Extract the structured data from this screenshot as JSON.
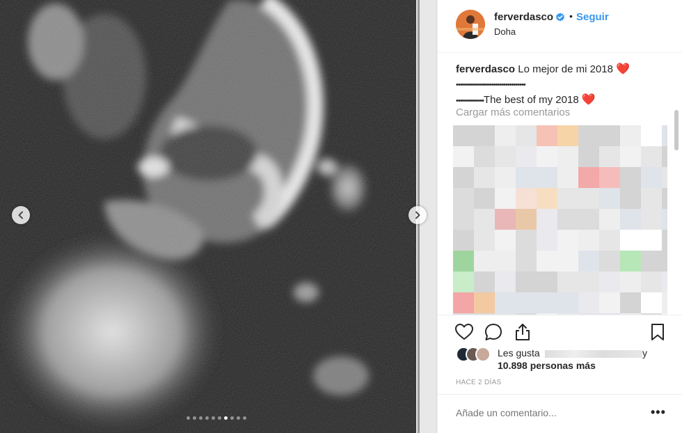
{
  "post": {
    "username": "ferverdasco",
    "follow_label": "Seguir",
    "location": "Doha",
    "separator": "•"
  },
  "caption": {
    "username": "ferverdasco",
    "line1": "Lo mejor de mi 2018",
    "heart": "❤️",
    "line2": "•••••••••••••••••••••••••••••••••••",
    "line3_dots": "••••••••••••••",
    "line3_text": "The best of my 2018",
    "heart2": "❤️"
  },
  "comments": {
    "load_more": "Cargar más comentarios"
  },
  "likes": {
    "prefix": "Les gusta",
    "suffix": "y",
    "count_text": "10.898 personas más"
  },
  "timestamp": "HACE 2 DÍAS",
  "comment_input": {
    "placeholder": "Añade un comentario..."
  },
  "more_options": "•••",
  "carousel": {
    "total": 10,
    "active_index": 6
  },
  "colors": {
    "accent": "#3897f0",
    "heart": "#e0241b",
    "muted": "#999999",
    "text": "#262626"
  },
  "icons": {
    "prev": "chevron-left-icon",
    "next": "chevron-right-icon",
    "like": "heart-icon",
    "comment": "comment-icon",
    "share": "share-icon",
    "save": "bookmark-icon",
    "verified": "verified-badge-icon"
  }
}
